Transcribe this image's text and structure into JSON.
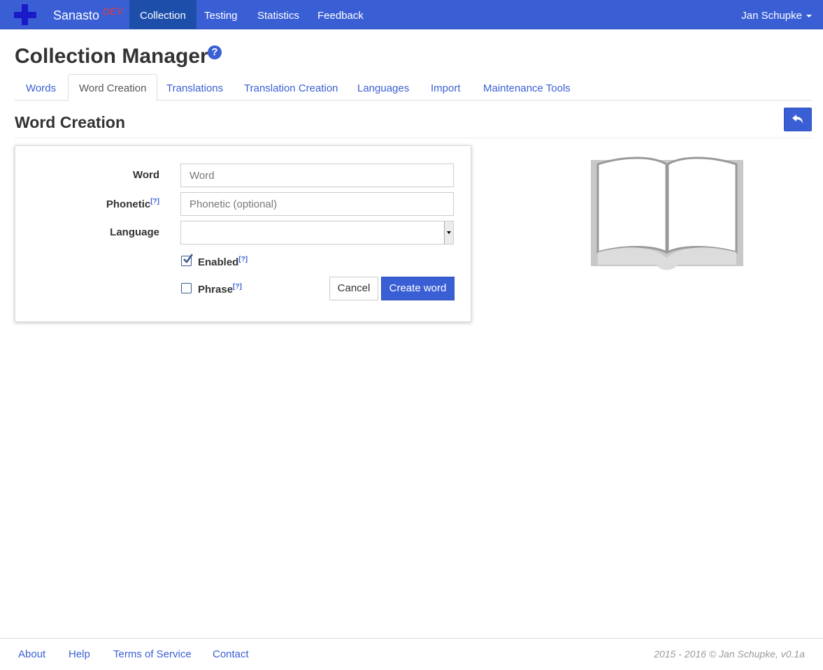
{
  "navbar": {
    "brand_name": "Sanasto",
    "brand_tag": "DEV",
    "items": [
      {
        "label": "Collection",
        "active": true
      },
      {
        "label": "Testing",
        "active": false
      },
      {
        "label": "Statistics",
        "active": false
      },
      {
        "label": "Feedback",
        "active": false
      }
    ],
    "user_name": "Jan Schupke",
    "accent_color": "#3a5fd5",
    "active_color": "#1d4eaa"
  },
  "header": {
    "title": "Collection Manager",
    "help_icon": "question-circle-icon",
    "help_glyph": "?"
  },
  "tabs": [
    {
      "label": "Words",
      "active": false
    },
    {
      "label": "Word Creation",
      "active": true
    },
    {
      "label": "Translations",
      "active": false
    },
    {
      "label": "Translation Creation",
      "active": false
    },
    {
      "label": "Languages",
      "active": false
    },
    {
      "label": "Import",
      "active": false
    },
    {
      "label": "Maintenance Tools",
      "active": false
    }
  ],
  "section": {
    "title": "Word Creation",
    "back_icon": "reply-icon"
  },
  "form": {
    "word": {
      "label": "Word",
      "value": "",
      "placeholder": "Word"
    },
    "phonetic": {
      "label": "Phonetic",
      "help": "[?]",
      "value": "",
      "placeholder": "Phonetic (optional)"
    },
    "language": {
      "label": "Language",
      "selected": ""
    },
    "enabled": {
      "label": "Enabled",
      "help": "[?]",
      "checked": true
    },
    "phrase": {
      "label": "Phrase",
      "help": "[?]",
      "checked": false
    },
    "cancel_label": "Cancel",
    "submit_label": "Create word"
  },
  "illustration": {
    "icon": "open-book-icon"
  },
  "footer": {
    "links": [
      "About",
      "Help",
      "Terms of Service",
      "Contact"
    ],
    "copyright": "2015 - 2016 © Jan Schupke, v0.1a"
  }
}
